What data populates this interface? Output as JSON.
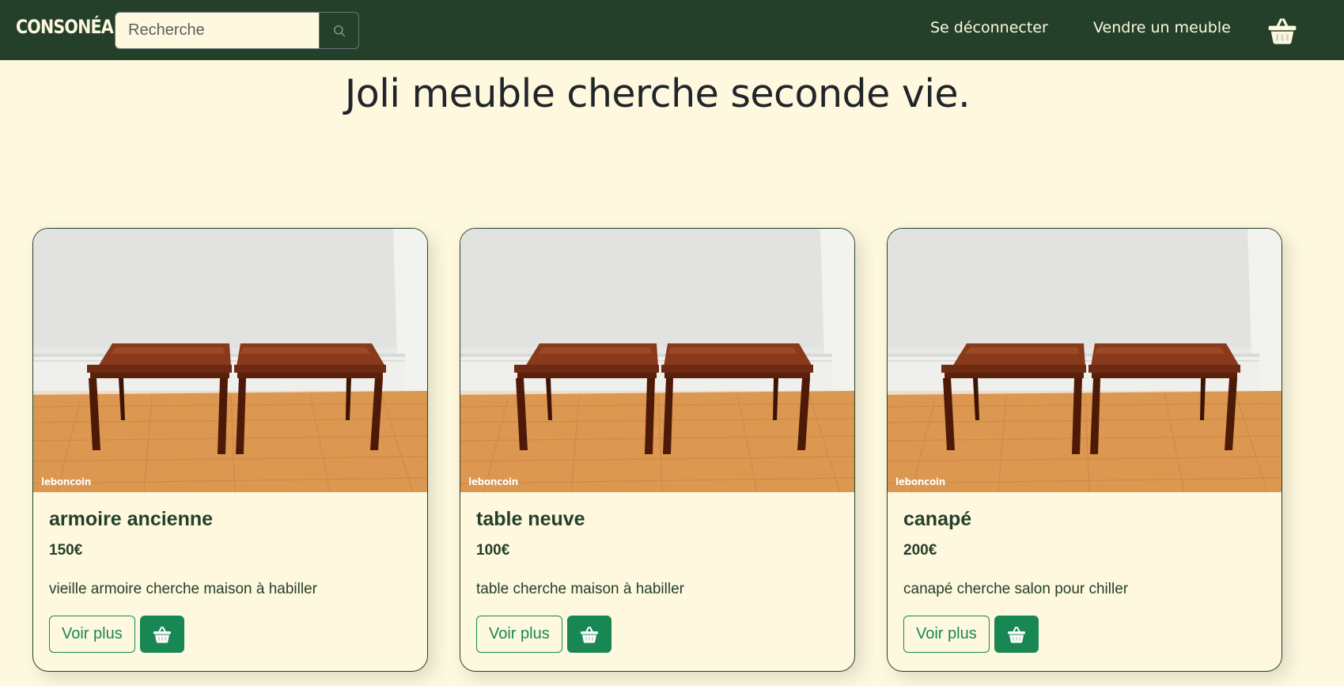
{
  "navbar": {
    "brand": "CONSONÉA",
    "search_placeholder": "Recherche",
    "search_value": "",
    "logout_label": "Se déconnecter",
    "sell_label": "Vendre un meuble",
    "basket_icon": "basket-icon"
  },
  "main": {
    "title": "Joli meuble cherche seconde vie."
  },
  "products": [
    {
      "name": "armoire ancienne",
      "price": "150€",
      "description": "vieille armoire cherche maison à habiller",
      "image_watermark": "leboncoin",
      "more_label": "Voir plus"
    },
    {
      "name": "table neuve",
      "price": "100€",
      "description": "table cherche maison à habiller",
      "image_watermark": "leboncoin",
      "more_label": "Voir plus"
    },
    {
      "name": "canapé",
      "price": "200€",
      "description": "canapé cherche salon pour chiller",
      "image_watermark": "leboncoin",
      "more_label": "Voir plus"
    }
  ],
  "colors": {
    "navbar_bg": "#24402b",
    "page_bg": "#fdf8de",
    "accent_green": "#198754",
    "text_dark_green": "#24402b"
  }
}
